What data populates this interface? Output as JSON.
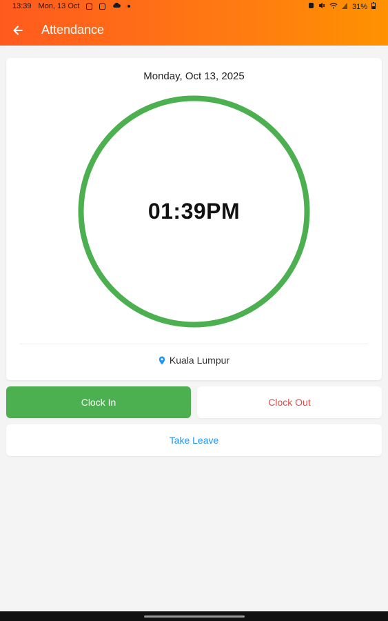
{
  "status_bar": {
    "time": "13:39",
    "date": "Mon, 13 Oct",
    "battery": "31%"
  },
  "app_bar": {
    "title": "Attendance",
    "back_icon": "arrow-left-icon"
  },
  "card": {
    "date": "Monday, Oct 13, 2025",
    "time": "01:39PM",
    "ring_color": "#4caf50",
    "location": "Kuala Lumpur",
    "location_icon": "map-pin-icon",
    "location_icon_color": "#2196f3"
  },
  "actions": {
    "clock_in": "Clock In",
    "clock_out": "Clock Out",
    "take_leave": "Take Leave"
  },
  "colors": {
    "header_gradient_start": "#ff5a1e",
    "header_gradient_end": "#ff9200",
    "clock_in_bg": "#4caf50",
    "clock_out_text": "#e04a4a",
    "take_leave_text": "#2196f3"
  }
}
